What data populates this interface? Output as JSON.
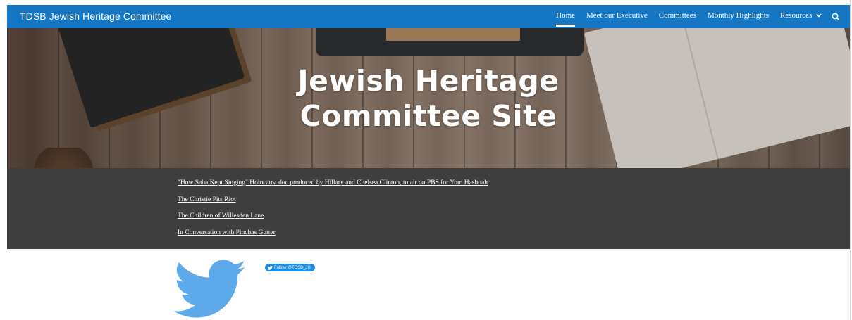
{
  "header": {
    "site_title": "TDSB Jewish Heritage Committee",
    "nav": [
      {
        "label": "Home",
        "active": true
      },
      {
        "label": "Meet our Executive"
      },
      {
        "label": "Committees"
      },
      {
        "label": "Monthly Highlights"
      },
      {
        "label": "Resources",
        "has_dropdown": true
      }
    ],
    "search_icon": "search-icon"
  },
  "hero": {
    "title_line1": "Jewish Heritage",
    "title_line2": "Committee Site"
  },
  "links": [
    "\"How Saba Kept Singing\" Holocaust doc produced by Hillary and Chelsea Clinton, to air on PBS for Yom Hashoah",
    "The Christie Pits Riot",
    "The Children of Willesden Lane",
    "In Conversation with Pinchas Gutter"
  ],
  "twitter": {
    "follow_label": "Follow @TDSB_JH",
    "icon": "twitter-bird-icon"
  },
  "colors": {
    "topbar": "#1576c4",
    "band": "#3e3e3e",
    "twitter_blue": "#5da9e9",
    "follow_button": "#1d8fe1"
  }
}
